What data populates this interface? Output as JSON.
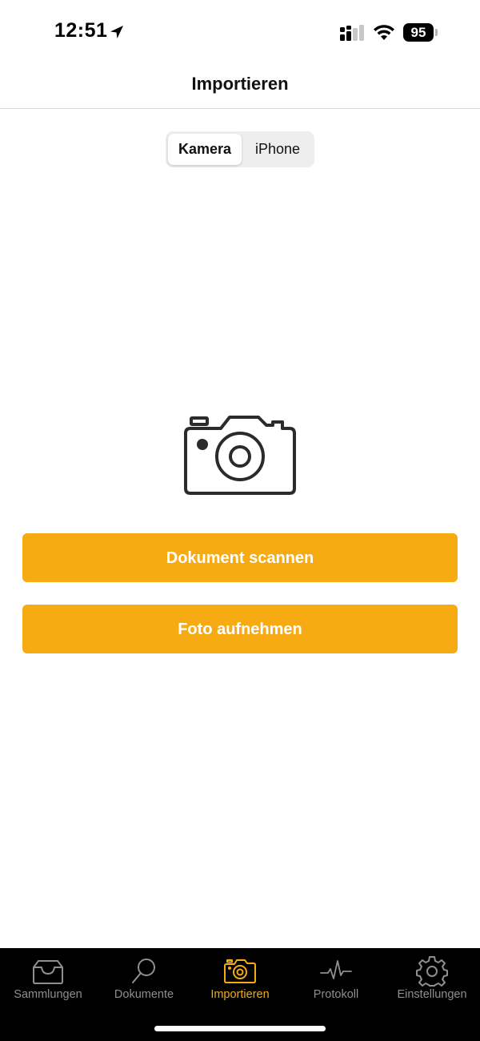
{
  "status_bar": {
    "time": "12:51",
    "battery": "95"
  },
  "header": {
    "title": "Importieren"
  },
  "segments": {
    "selected": "Kamera",
    "other": "iPhone"
  },
  "actions": {
    "scan_label": "Dokument scannen",
    "photo_label": "Foto aufnehmen"
  },
  "tabs": [
    {
      "label": "Sammlungen",
      "icon": "tray-icon"
    },
    {
      "label": "Dokumente",
      "icon": "search-icon"
    },
    {
      "label": "Importieren",
      "icon": "camera-icon"
    },
    {
      "label": "Protokoll",
      "icon": "activity-icon"
    },
    {
      "label": "Einstellungen",
      "icon": "gear-icon"
    }
  ],
  "active_tab": "Importieren",
  "colors": {
    "accent": "#f7ab12",
    "tab_inactive": "#8e8e93",
    "tab_bar_bg": "#000000"
  }
}
